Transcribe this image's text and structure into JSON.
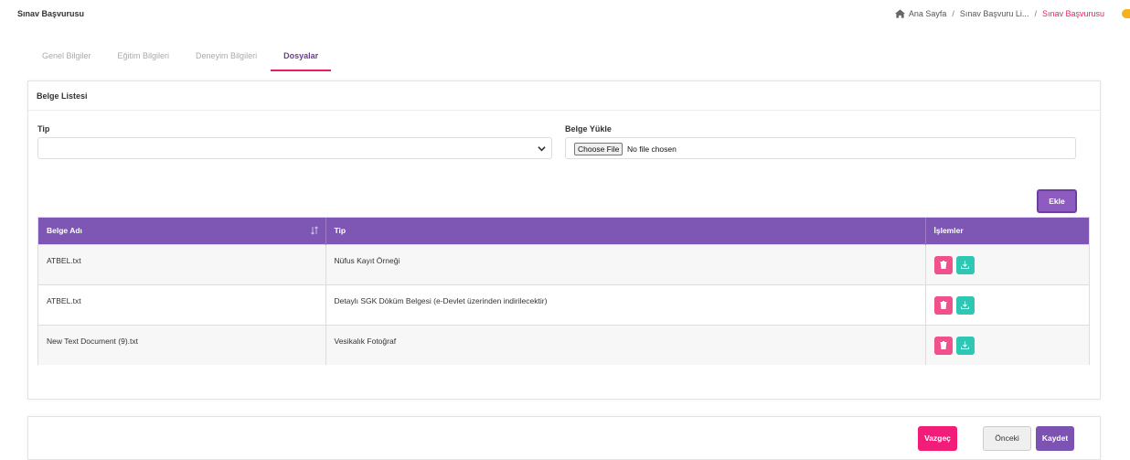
{
  "page": {
    "title": "Sınav Başvurusu"
  },
  "breadcrumb": {
    "home": "Ana Sayfa",
    "sep": "/",
    "list": "Sınav Başvuru Li...",
    "current": "Sınav Başvurusu"
  },
  "tabs": [
    "Genel Bilgiler",
    "Eğitim Bilgileri",
    "Deneyim Bilgileri",
    "Dosyalar"
  ],
  "active_tab": "Dosyalar",
  "card": {
    "title": "Belge Listesi",
    "tip_label": "Tip",
    "tip_value": "",
    "upload_label": "Belge Yükle",
    "file_button": "Choose File",
    "file_status": "No file chosen",
    "add_button": "Ekle"
  },
  "table": {
    "columns": [
      "Belge Adı",
      "Tip",
      "İşlemler"
    ],
    "rows": [
      {
        "name": "ATBEL.txt",
        "type": "Nüfus Kayıt Örneği"
      },
      {
        "name": "ATBEL.txt",
        "type": "Detaylı SGK Döküm Belgesi (e-Devlet üzerinden indirilecektir)"
      },
      {
        "name": "New Text Document (9).txt",
        "type": "Vesikalık Fotoğraf"
      }
    ]
  },
  "footer": {
    "cancel": "Vazgeç",
    "previous": "Önceki",
    "save": "Kaydet"
  },
  "colors": {
    "purple": "#7e57b5",
    "pink": "#f21d79",
    "teal": "#2fc6b3",
    "orange": "#f6b21a"
  }
}
